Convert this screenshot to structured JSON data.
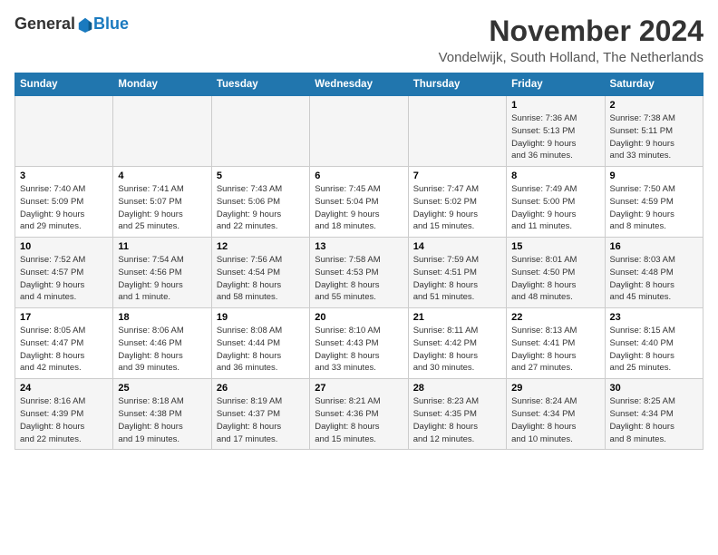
{
  "header": {
    "logo_general": "General",
    "logo_blue": "Blue",
    "title": "November 2024",
    "subtitle": "Vondelwijk, South Holland, The Netherlands"
  },
  "weekdays": [
    "Sunday",
    "Monday",
    "Tuesday",
    "Wednesday",
    "Thursday",
    "Friday",
    "Saturday"
  ],
  "weeks": [
    {
      "days": [
        {
          "num": "",
          "info": ""
        },
        {
          "num": "",
          "info": ""
        },
        {
          "num": "",
          "info": ""
        },
        {
          "num": "",
          "info": ""
        },
        {
          "num": "",
          "info": ""
        },
        {
          "num": "1",
          "info": "Sunrise: 7:36 AM\nSunset: 5:13 PM\nDaylight: 9 hours\nand 36 minutes."
        },
        {
          "num": "2",
          "info": "Sunrise: 7:38 AM\nSunset: 5:11 PM\nDaylight: 9 hours\nand 33 minutes."
        }
      ]
    },
    {
      "days": [
        {
          "num": "3",
          "info": "Sunrise: 7:40 AM\nSunset: 5:09 PM\nDaylight: 9 hours\nand 29 minutes."
        },
        {
          "num": "4",
          "info": "Sunrise: 7:41 AM\nSunset: 5:07 PM\nDaylight: 9 hours\nand 25 minutes."
        },
        {
          "num": "5",
          "info": "Sunrise: 7:43 AM\nSunset: 5:06 PM\nDaylight: 9 hours\nand 22 minutes."
        },
        {
          "num": "6",
          "info": "Sunrise: 7:45 AM\nSunset: 5:04 PM\nDaylight: 9 hours\nand 18 minutes."
        },
        {
          "num": "7",
          "info": "Sunrise: 7:47 AM\nSunset: 5:02 PM\nDaylight: 9 hours\nand 15 minutes."
        },
        {
          "num": "8",
          "info": "Sunrise: 7:49 AM\nSunset: 5:00 PM\nDaylight: 9 hours\nand 11 minutes."
        },
        {
          "num": "9",
          "info": "Sunrise: 7:50 AM\nSunset: 4:59 PM\nDaylight: 9 hours\nand 8 minutes."
        }
      ]
    },
    {
      "days": [
        {
          "num": "10",
          "info": "Sunrise: 7:52 AM\nSunset: 4:57 PM\nDaylight: 9 hours\nand 4 minutes."
        },
        {
          "num": "11",
          "info": "Sunrise: 7:54 AM\nSunset: 4:56 PM\nDaylight: 9 hours\nand 1 minute."
        },
        {
          "num": "12",
          "info": "Sunrise: 7:56 AM\nSunset: 4:54 PM\nDaylight: 8 hours\nand 58 minutes."
        },
        {
          "num": "13",
          "info": "Sunrise: 7:58 AM\nSunset: 4:53 PM\nDaylight: 8 hours\nand 55 minutes."
        },
        {
          "num": "14",
          "info": "Sunrise: 7:59 AM\nSunset: 4:51 PM\nDaylight: 8 hours\nand 51 minutes."
        },
        {
          "num": "15",
          "info": "Sunrise: 8:01 AM\nSunset: 4:50 PM\nDaylight: 8 hours\nand 48 minutes."
        },
        {
          "num": "16",
          "info": "Sunrise: 8:03 AM\nSunset: 4:48 PM\nDaylight: 8 hours\nand 45 minutes."
        }
      ]
    },
    {
      "days": [
        {
          "num": "17",
          "info": "Sunrise: 8:05 AM\nSunset: 4:47 PM\nDaylight: 8 hours\nand 42 minutes."
        },
        {
          "num": "18",
          "info": "Sunrise: 8:06 AM\nSunset: 4:46 PM\nDaylight: 8 hours\nand 39 minutes."
        },
        {
          "num": "19",
          "info": "Sunrise: 8:08 AM\nSunset: 4:44 PM\nDaylight: 8 hours\nand 36 minutes."
        },
        {
          "num": "20",
          "info": "Sunrise: 8:10 AM\nSunset: 4:43 PM\nDaylight: 8 hours\nand 33 minutes."
        },
        {
          "num": "21",
          "info": "Sunrise: 8:11 AM\nSunset: 4:42 PM\nDaylight: 8 hours\nand 30 minutes."
        },
        {
          "num": "22",
          "info": "Sunrise: 8:13 AM\nSunset: 4:41 PM\nDaylight: 8 hours\nand 27 minutes."
        },
        {
          "num": "23",
          "info": "Sunrise: 8:15 AM\nSunset: 4:40 PM\nDaylight: 8 hours\nand 25 minutes."
        }
      ]
    },
    {
      "days": [
        {
          "num": "24",
          "info": "Sunrise: 8:16 AM\nSunset: 4:39 PM\nDaylight: 8 hours\nand 22 minutes."
        },
        {
          "num": "25",
          "info": "Sunrise: 8:18 AM\nSunset: 4:38 PM\nDaylight: 8 hours\nand 19 minutes."
        },
        {
          "num": "26",
          "info": "Sunrise: 8:19 AM\nSunset: 4:37 PM\nDaylight: 8 hours\nand 17 minutes."
        },
        {
          "num": "27",
          "info": "Sunrise: 8:21 AM\nSunset: 4:36 PM\nDaylight: 8 hours\nand 15 minutes."
        },
        {
          "num": "28",
          "info": "Sunrise: 8:23 AM\nSunset: 4:35 PM\nDaylight: 8 hours\nand 12 minutes."
        },
        {
          "num": "29",
          "info": "Sunrise: 8:24 AM\nSunset: 4:34 PM\nDaylight: 8 hours\nand 10 minutes."
        },
        {
          "num": "30",
          "info": "Sunrise: 8:25 AM\nSunset: 4:34 PM\nDaylight: 8 hours\nand 8 minutes."
        }
      ]
    }
  ]
}
